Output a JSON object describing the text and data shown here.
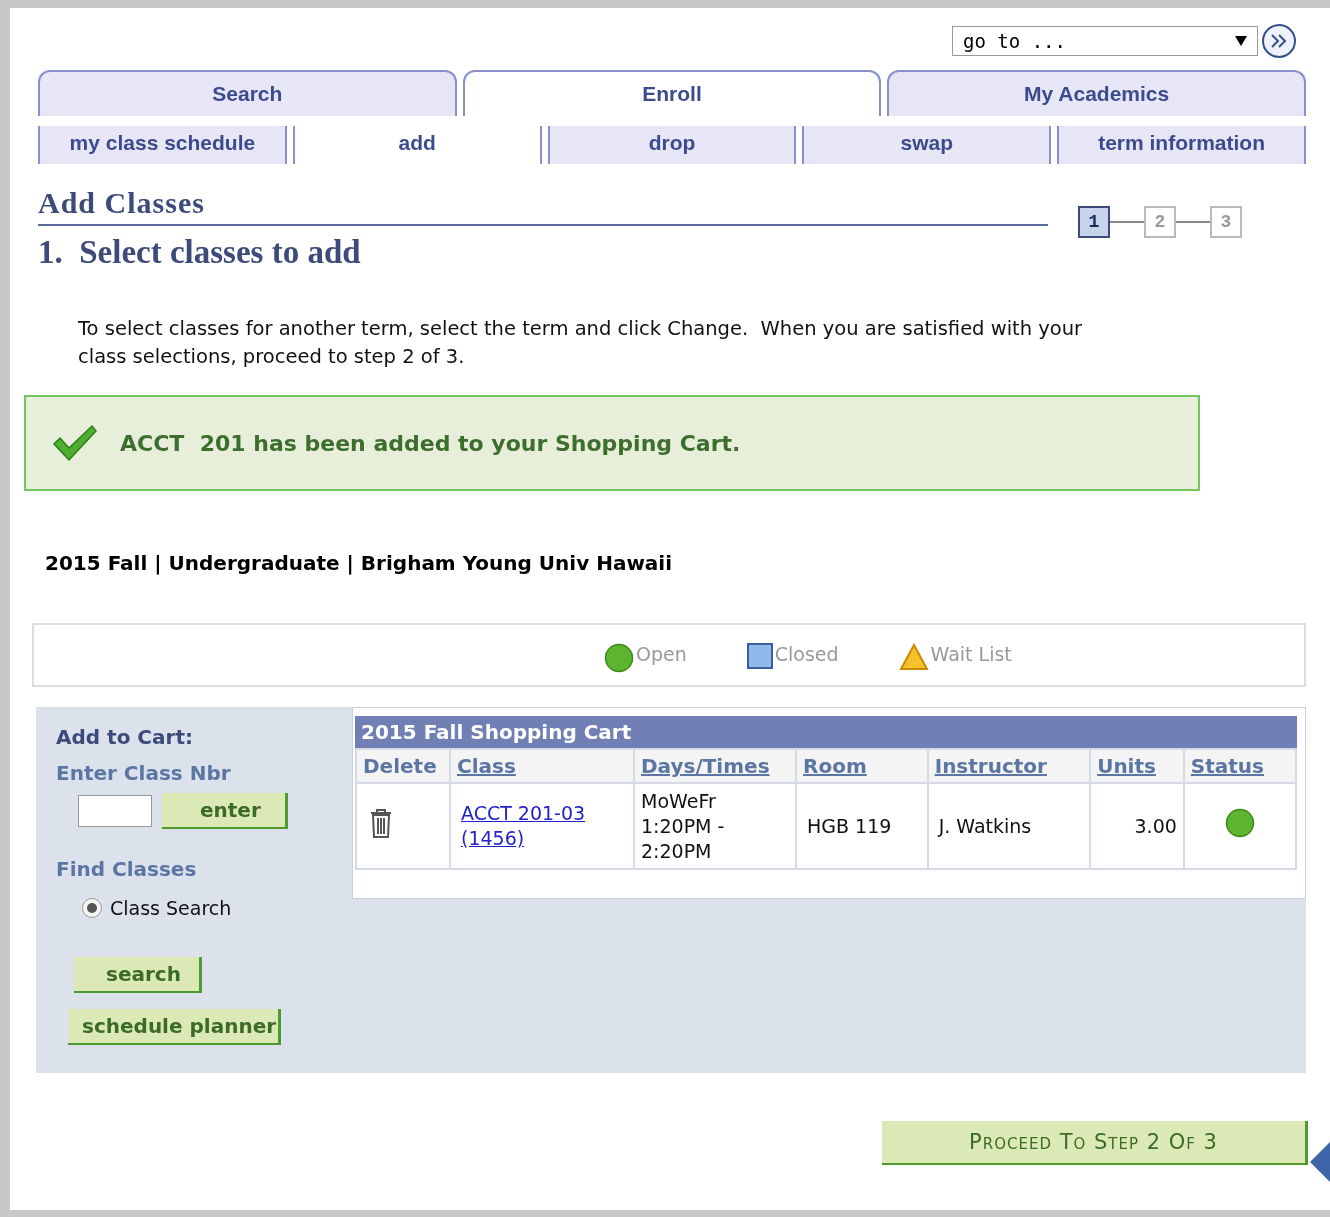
{
  "goto": {
    "value": "go to ..."
  },
  "tabs": [
    {
      "label": "Search",
      "selected": false
    },
    {
      "label": "Enroll",
      "selected": true
    },
    {
      "label": "My Academics",
      "selected": false
    }
  ],
  "subtabs": [
    {
      "label": "my class schedule",
      "selected": false
    },
    {
      "label": "add",
      "selected": true
    },
    {
      "label": "drop",
      "selected": false
    },
    {
      "label": "swap",
      "selected": false
    },
    {
      "label": "term information",
      "selected": false
    }
  ],
  "page_title": "Add Classes",
  "steps": [
    {
      "label": "1",
      "selected": true
    },
    {
      "label": "2",
      "selected": false
    },
    {
      "label": "3",
      "selected": false
    }
  ],
  "step_heading": "1.  Select classes to add",
  "instructions": "To select classes for another term, select the term and click Change.  When you are satisfied with your class selections, proceed to step 2 of 3.",
  "message": "ACCT  201 has been added to your Shopping Cart.",
  "term_line": "2015 Fall | Undergraduate | Brigham Young Univ Hawaii",
  "legend": [
    {
      "kind": "open",
      "label": "Open"
    },
    {
      "kind": "closed",
      "label": "Closed"
    },
    {
      "kind": "waitlist",
      "label": "Wait List"
    }
  ],
  "add_panel": {
    "title": "Add to Cart:",
    "class_nbr_label": "Enter Class Nbr",
    "enter_button": "enter",
    "find_label": "Find Classes",
    "options": [
      {
        "label": "Class Search",
        "selected": true
      }
    ],
    "buttons": [
      "search",
      "schedule planner"
    ]
  },
  "cart": {
    "title": "2015 Fall Shopping Cart",
    "columns": [
      "Delete",
      "Class",
      "Days/Times",
      "Room",
      "Instructor",
      "Units",
      "Status"
    ],
    "rows": [
      {
        "class": "ACCT 201-03 (1456)",
        "days_times": "MoWeFr\n1:20PM -\n2:20PM",
        "room": "HGB 119",
        "instructor": "J. Watkins",
        "units": "3.00",
        "open": true
      }
    ]
  },
  "proceed_button": "Proceed To Step 2 Of 3"
}
